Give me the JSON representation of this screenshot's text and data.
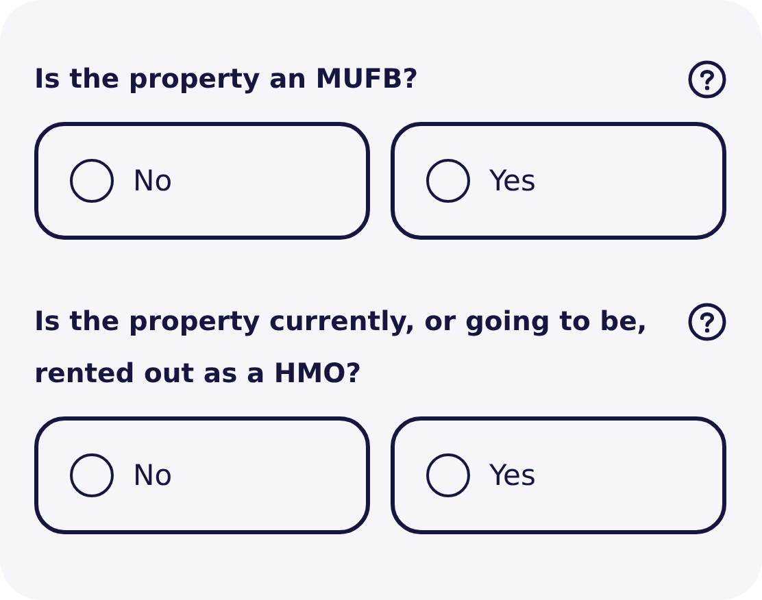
{
  "questions": [
    {
      "label": "Is the property an MUFB?",
      "options": [
        {
          "label": "No",
          "selected": false
        },
        {
          "label": "Yes",
          "selected": false
        }
      ]
    },
    {
      "label": "Is the property currently, or going to be, rented out as a HMO?",
      "options": [
        {
          "label": "No",
          "selected": false
        },
        {
          "label": "Yes",
          "selected": false
        }
      ]
    }
  ]
}
